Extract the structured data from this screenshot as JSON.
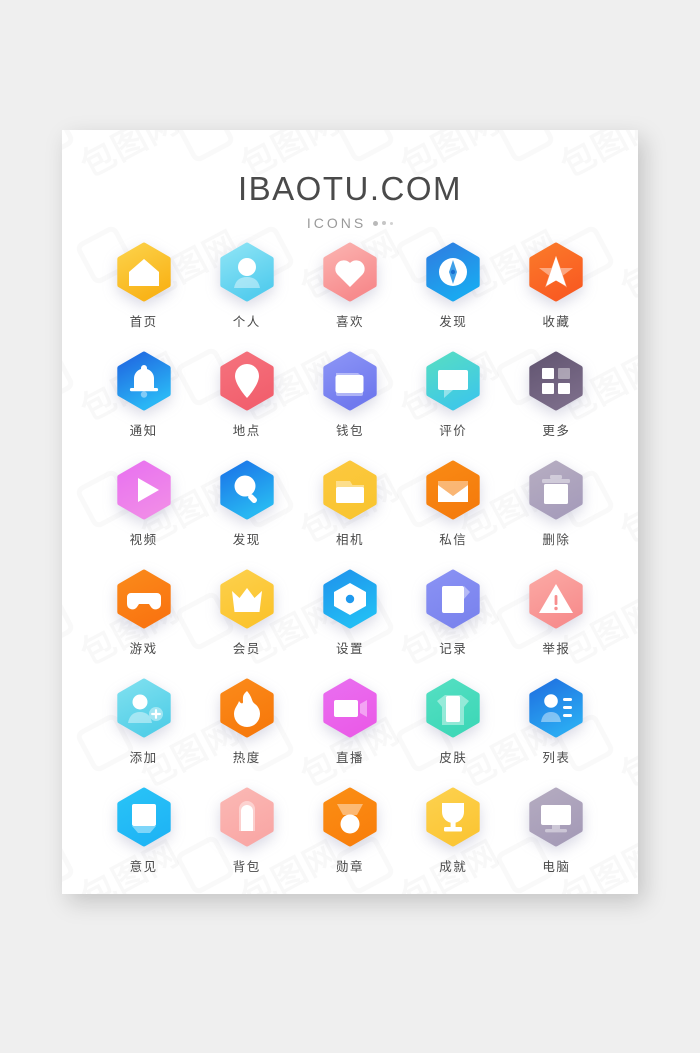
{
  "page": {
    "background_color": "#efefef",
    "card_background": "#ffffff"
  },
  "header": {
    "title": "IBAOTU.COM",
    "subtitle": "ICONS",
    "dot_count": 3
  },
  "watermark": {
    "text": "包图网",
    "repeat": true
  },
  "grid": {
    "columns": 5,
    "rows": 6,
    "icons": [
      {
        "label": "首页",
        "icon": "home-icon",
        "color1": "#fcd24a",
        "color2": "#f9b419"
      },
      {
        "label": "个人",
        "icon": "person-icon",
        "color1": "#8ee4f5",
        "color2": "#55cdee"
      },
      {
        "label": "喜欢",
        "icon": "heart-icon",
        "color1": "#fbb3b0",
        "color2": "#f78b8d"
      },
      {
        "label": "发现",
        "icon": "compass-icon",
        "color1": "#2f7de1",
        "color2": "#1aa8f0"
      },
      {
        "label": "收藏",
        "icon": "star-arrow-icon",
        "color1": "#fb7a2a",
        "color2": "#f95c22"
      },
      {
        "label": "通知",
        "icon": "bell-icon",
        "color1": "#1f63e0",
        "color2": "#2ab6f5"
      },
      {
        "label": "地点",
        "icon": "map-pin-icon",
        "color1": "#f5727d",
        "color2": "#f2606e"
      },
      {
        "label": "钱包",
        "icon": "wallet-icon",
        "color1": "#8c95f6",
        "color2": "#7079ee"
      },
      {
        "label": "评价",
        "icon": "chat-bubble-icon",
        "color1": "#57ddc3",
        "color2": "#3fc9e6"
      },
      {
        "label": "更多",
        "icon": "grid-more-icon",
        "color1": "#625571",
        "color2": "#7a6b88"
      },
      {
        "label": "视频",
        "icon": "play-video-icon",
        "color1": "#e871f0",
        "color2": "#f08ae8"
      },
      {
        "label": "发现",
        "icon": "search-icon",
        "color1": "#1a72e8",
        "color2": "#28b7f2"
      },
      {
        "label": "相机",
        "icon": "camera-icon",
        "color1": "#fcc83f",
        "color2": "#f9c531"
      },
      {
        "label": "私信",
        "icon": "mail-icon",
        "color1": "#f98a14",
        "color2": "#f57c0d"
      },
      {
        "label": "删除",
        "icon": "trash-icon",
        "color1": "#b6adc1",
        "color2": "#a79dbb"
      },
      {
        "label": "游戏",
        "icon": "gamepad-icon",
        "color1": "#fb8a1a",
        "color2": "#f97511"
      },
      {
        "label": "会员",
        "icon": "crown-icon",
        "color1": "#fdd04c",
        "color2": "#fbc42e"
      },
      {
        "label": "设置",
        "icon": "settings-icon",
        "color1": "#1f93ec",
        "color2": "#22bcf4"
      },
      {
        "label": "记录",
        "icon": "document-icon",
        "color1": "#8a92f4",
        "color2": "#7b84ee"
      },
      {
        "label": "举报",
        "icon": "warning-icon",
        "color1": "#fba9a4",
        "color2": "#f78e8e"
      },
      {
        "label": "添加",
        "icon": "add-user-icon",
        "color1": "#7fe0ef",
        "color2": "#54cfe8"
      },
      {
        "label": "热度",
        "icon": "flame-icon",
        "color1": "#fb8a1a",
        "color2": "#f77a0c"
      },
      {
        "label": "直播",
        "icon": "live-video-icon",
        "color1": "#e96ef0",
        "color2": "#ea5ce8"
      },
      {
        "label": "皮肤",
        "icon": "shirt-icon",
        "color1": "#54dfc2",
        "color2": "#3fd8b8"
      },
      {
        "label": "列表",
        "icon": "list-contact-icon",
        "color1": "#1f6fe0",
        "color2": "#2aa9f2"
      },
      {
        "label": "意见",
        "icon": "feedback-icon",
        "color1": "#29c3f7",
        "color2": "#1fb5f5"
      },
      {
        "label": "背包",
        "icon": "backpack-icon",
        "color1": "#fbb8b4",
        "color2": "#f9a8a6"
      },
      {
        "label": "勋章",
        "icon": "medal-icon",
        "color1": "#fb8e14",
        "color2": "#f9800c"
      },
      {
        "label": "成就",
        "icon": "trophy-icon",
        "color1": "#fdd14e",
        "color2": "#fbc636"
      },
      {
        "label": "电脑",
        "icon": "computer-icon",
        "color1": "#b4abc0",
        "color2": "#a69cb8"
      }
    ]
  }
}
